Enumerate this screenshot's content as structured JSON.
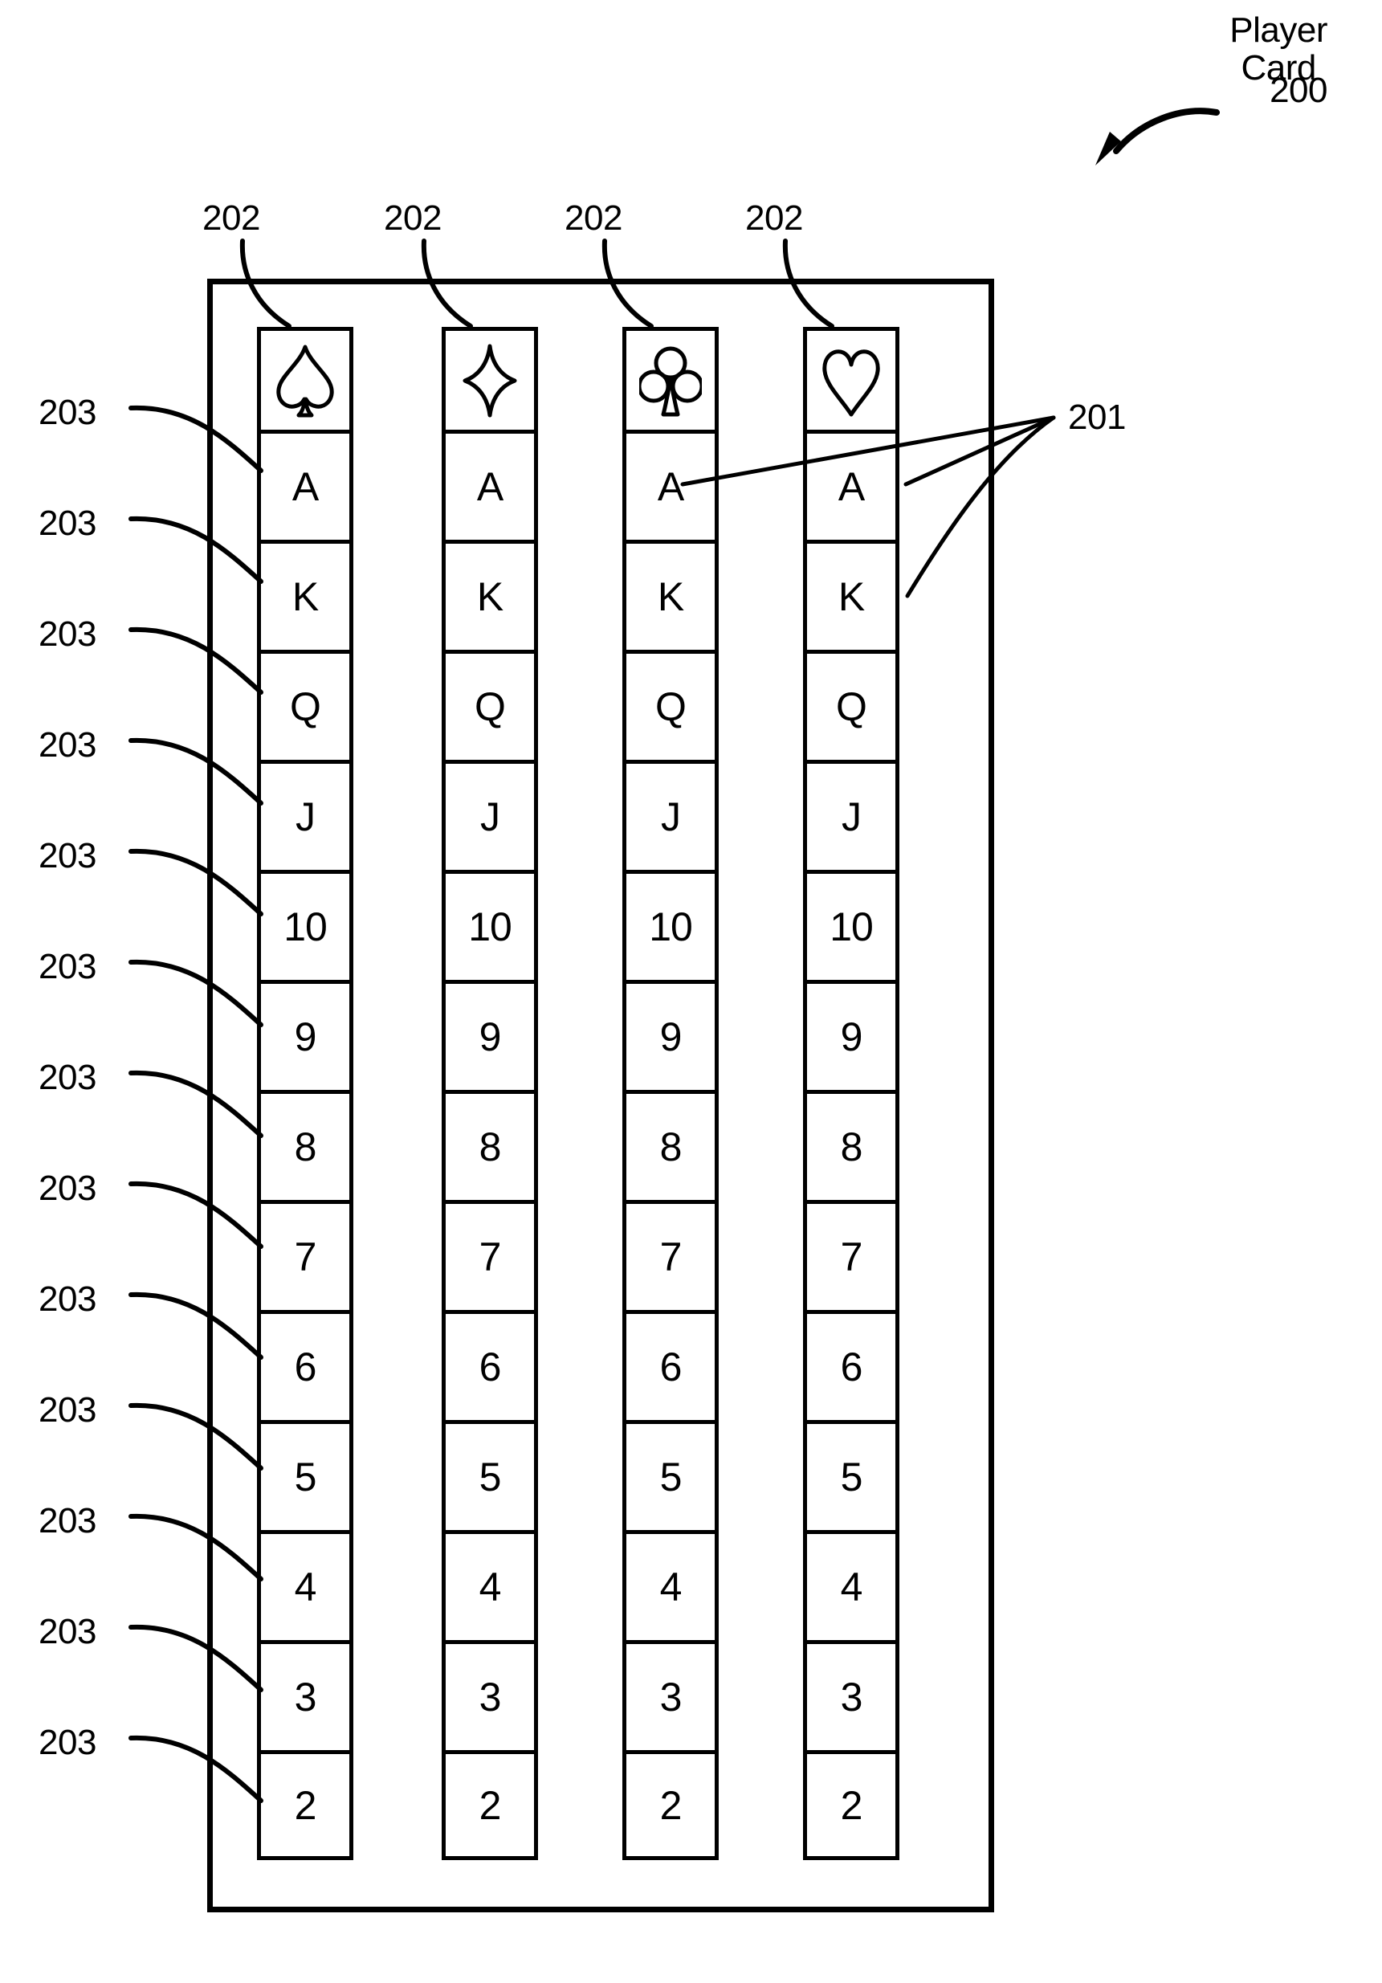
{
  "figure": {
    "title_lines": [
      "Player",
      "Card"
    ],
    "title_ref": "200",
    "kind": "patent-line-drawing"
  },
  "card": {
    "name": "Player Card",
    "ref": "200",
    "suit_row_ref": "202",
    "rank_row_ref": "203",
    "cell_ref": "201",
    "columns": [
      {
        "suit_name": "spade-suit-icon",
        "suit_symbol": "♠",
        "ref": "202"
      },
      {
        "suit_name": "diamond-suit-icon",
        "suit_symbol": "♦",
        "ref": "202"
      },
      {
        "suit_name": "club-suit-icon",
        "suit_symbol": "♣",
        "ref": "202"
      },
      {
        "suit_name": "heart-suit-icon",
        "suit_symbol": "♥",
        "ref": "202"
      }
    ],
    "ranks": [
      "A",
      "K",
      "Q",
      "J",
      "10",
      "9",
      "8",
      "7",
      "6",
      "5",
      "4",
      "3",
      "2"
    ],
    "row_refs": [
      "203",
      "203",
      "203",
      "203",
      "203",
      "203",
      "203",
      "203",
      "203",
      "203",
      "203",
      "203",
      "203"
    ]
  },
  "colors": {
    "ink": "#000000",
    "paper": "#ffffff"
  }
}
